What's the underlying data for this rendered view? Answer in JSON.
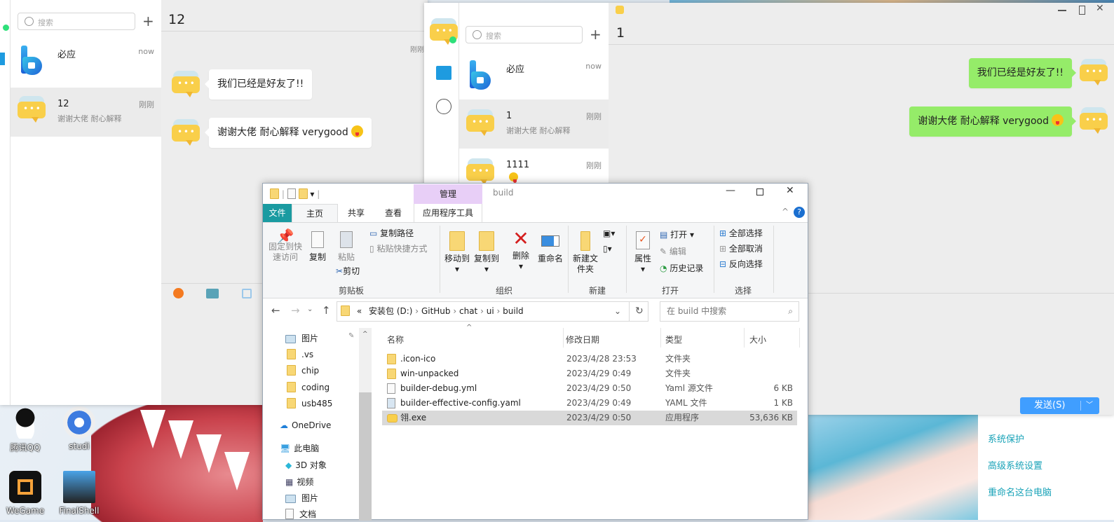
{
  "desktop": {
    "icons": [
      {
        "label": "腾讯QQ"
      },
      {
        "label": "studi"
      },
      {
        "label": "WeGame"
      },
      {
        "label": "FinalShell"
      }
    ],
    "system_links": [
      "系统保护",
      "高级系统设置",
      "重命名这台电脑"
    ]
  },
  "chat_left": {
    "search_placeholder": "搜索",
    "conversations": [
      {
        "name": "必应",
        "preview": "",
        "time": "now"
      },
      {
        "name": "12",
        "preview": "谢谢大佬 耐心解释",
        "time": "刚刚"
      }
    ],
    "title": "12",
    "timestamp": "刚刚",
    "messages": [
      {
        "text": "我们已经是好友了!!",
        "side": "left"
      },
      {
        "text": "谢谢大佬 耐心解释 verygood",
        "side": "left",
        "emoji": "tongue-wink-emoji"
      }
    ]
  },
  "chat_right": {
    "search_placeholder": "搜索",
    "conversations": [
      {
        "name": "必应",
        "preview": "",
        "time": "now"
      },
      {
        "name": "1",
        "preview": "谢谢大佬 耐心解释",
        "time": "刚刚"
      },
      {
        "name": "1111",
        "preview": "",
        "time": "刚刚"
      }
    ],
    "title": "1",
    "messages": [
      {
        "text": "我们已经是好友了!!",
        "side": "right"
      },
      {
        "text": "谢谢大佬 耐心解释 verygood",
        "side": "right",
        "emoji": "tongue-wink-emoji"
      }
    ],
    "send_label": "发送(S)",
    "colors": {
      "sent_bubble": "#95ec69",
      "send_button": "#409eff",
      "online": "#2ee07a"
    }
  },
  "explorer": {
    "title": "build",
    "context_tab": "管理",
    "tabs": [
      "文件",
      "主页",
      "共享",
      "查看",
      "应用程序工具"
    ],
    "ribbon": {
      "pin": "固定到快速访问",
      "copy": "复制",
      "paste": "粘贴",
      "copy_path": "复制路径",
      "paste_shortcut": "粘贴快捷方式",
      "cut": "剪切",
      "move_to": "移动到",
      "copy_to": "复制到",
      "delete": "删除",
      "rename": "重命名",
      "new_folder": "新建文件夹",
      "properties": "属性",
      "open": "打开",
      "edit": "编辑",
      "history": "历史记录",
      "select_all": "全部选择",
      "select_none": "全部取消",
      "invert": "反向选择",
      "groups": [
        "剪贴板",
        "组织",
        "新建",
        "打开",
        "选择"
      ]
    },
    "address": [
      "«",
      "安装包 (D:)",
      "GitHub",
      "chat",
      "ui",
      "build"
    ],
    "search_placeholder": "在 build 中搜索",
    "nav": [
      ".vs",
      "chip",
      "coding",
      "usb485",
      "OneDrive",
      "此电脑",
      "3D 对象",
      "视频",
      "图片",
      "图片",
      "文档"
    ],
    "columns": [
      "名称",
      "修改日期",
      "类型",
      "大小"
    ],
    "files": [
      {
        "name": ".icon-ico",
        "date": "2023/4/28 23:53",
        "type": "文件夹",
        "size": "",
        "icon": "folder"
      },
      {
        "name": "win-unpacked",
        "date": "2023/4/29 0:49",
        "type": "文件夹",
        "size": "",
        "icon": "folder"
      },
      {
        "name": "builder-debug.yml",
        "date": "2023/4/29 0:50",
        "type": "Yaml 源文件",
        "size": "6 KB",
        "icon": "file"
      },
      {
        "name": "builder-effective-config.yaml",
        "date": "2023/4/29 0:49",
        "type": "YAML 文件",
        "size": "1 KB",
        "icon": "file"
      },
      {
        "name": "翎.exe",
        "date": "2023/4/29 0:50",
        "type": "应用程序",
        "size": "53,636 KB",
        "icon": "app",
        "selected": true
      }
    ],
    "colors": {
      "file_tab": "#1a9ba1",
      "manage_tab": "#e8cff7"
    }
  }
}
